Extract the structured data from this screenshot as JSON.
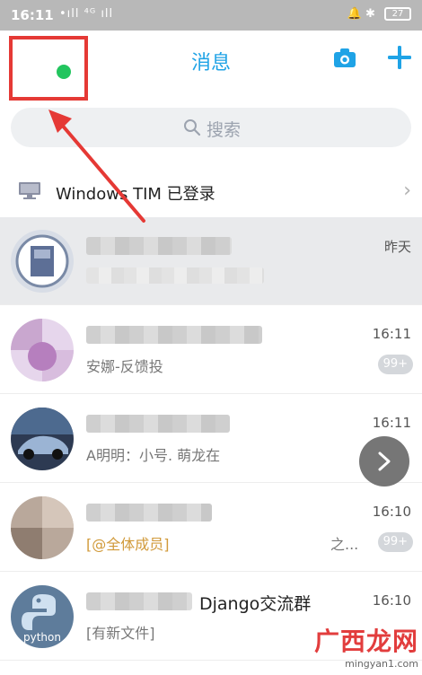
{
  "status_bar": {
    "time": "16:11",
    "signal": "•ıll ⁴ᴳ ıll",
    "right_icons": "🔔 ✱",
    "battery": "27"
  },
  "header": {
    "title": "消息",
    "icons": [
      "camera-icon",
      "plus-icon"
    ]
  },
  "search": {
    "placeholder": "搜索"
  },
  "tim_row": {
    "label": "Windows TIM 已登录",
    "icon": "desktop-icon"
  },
  "chats": [
    {
      "time": "昨天",
      "preview": "",
      "badge": ""
    },
    {
      "time": "16:11",
      "preview": "安娜-反馈投",
      "badge": "99+"
    },
    {
      "time": "16:11",
      "preview": "A明明：小号. 萌龙在",
      "badge": ""
    },
    {
      "time": "16:10",
      "preview": "[@全体成员]",
      "preview_suffix": "之...",
      "badge": "99+"
    },
    {
      "name": "Django交流群",
      "time": "16:10",
      "preview": "[有新文件]",
      "badge": ""
    }
  ],
  "avatar_texts": {
    "python": "python"
  },
  "watermark": {
    "cn": "广西龙网",
    "url": "mingyan1.com"
  },
  "colors": {
    "accent": "#1fa3e6",
    "highlight_box": "#e53935",
    "online": "#22c55e"
  }
}
